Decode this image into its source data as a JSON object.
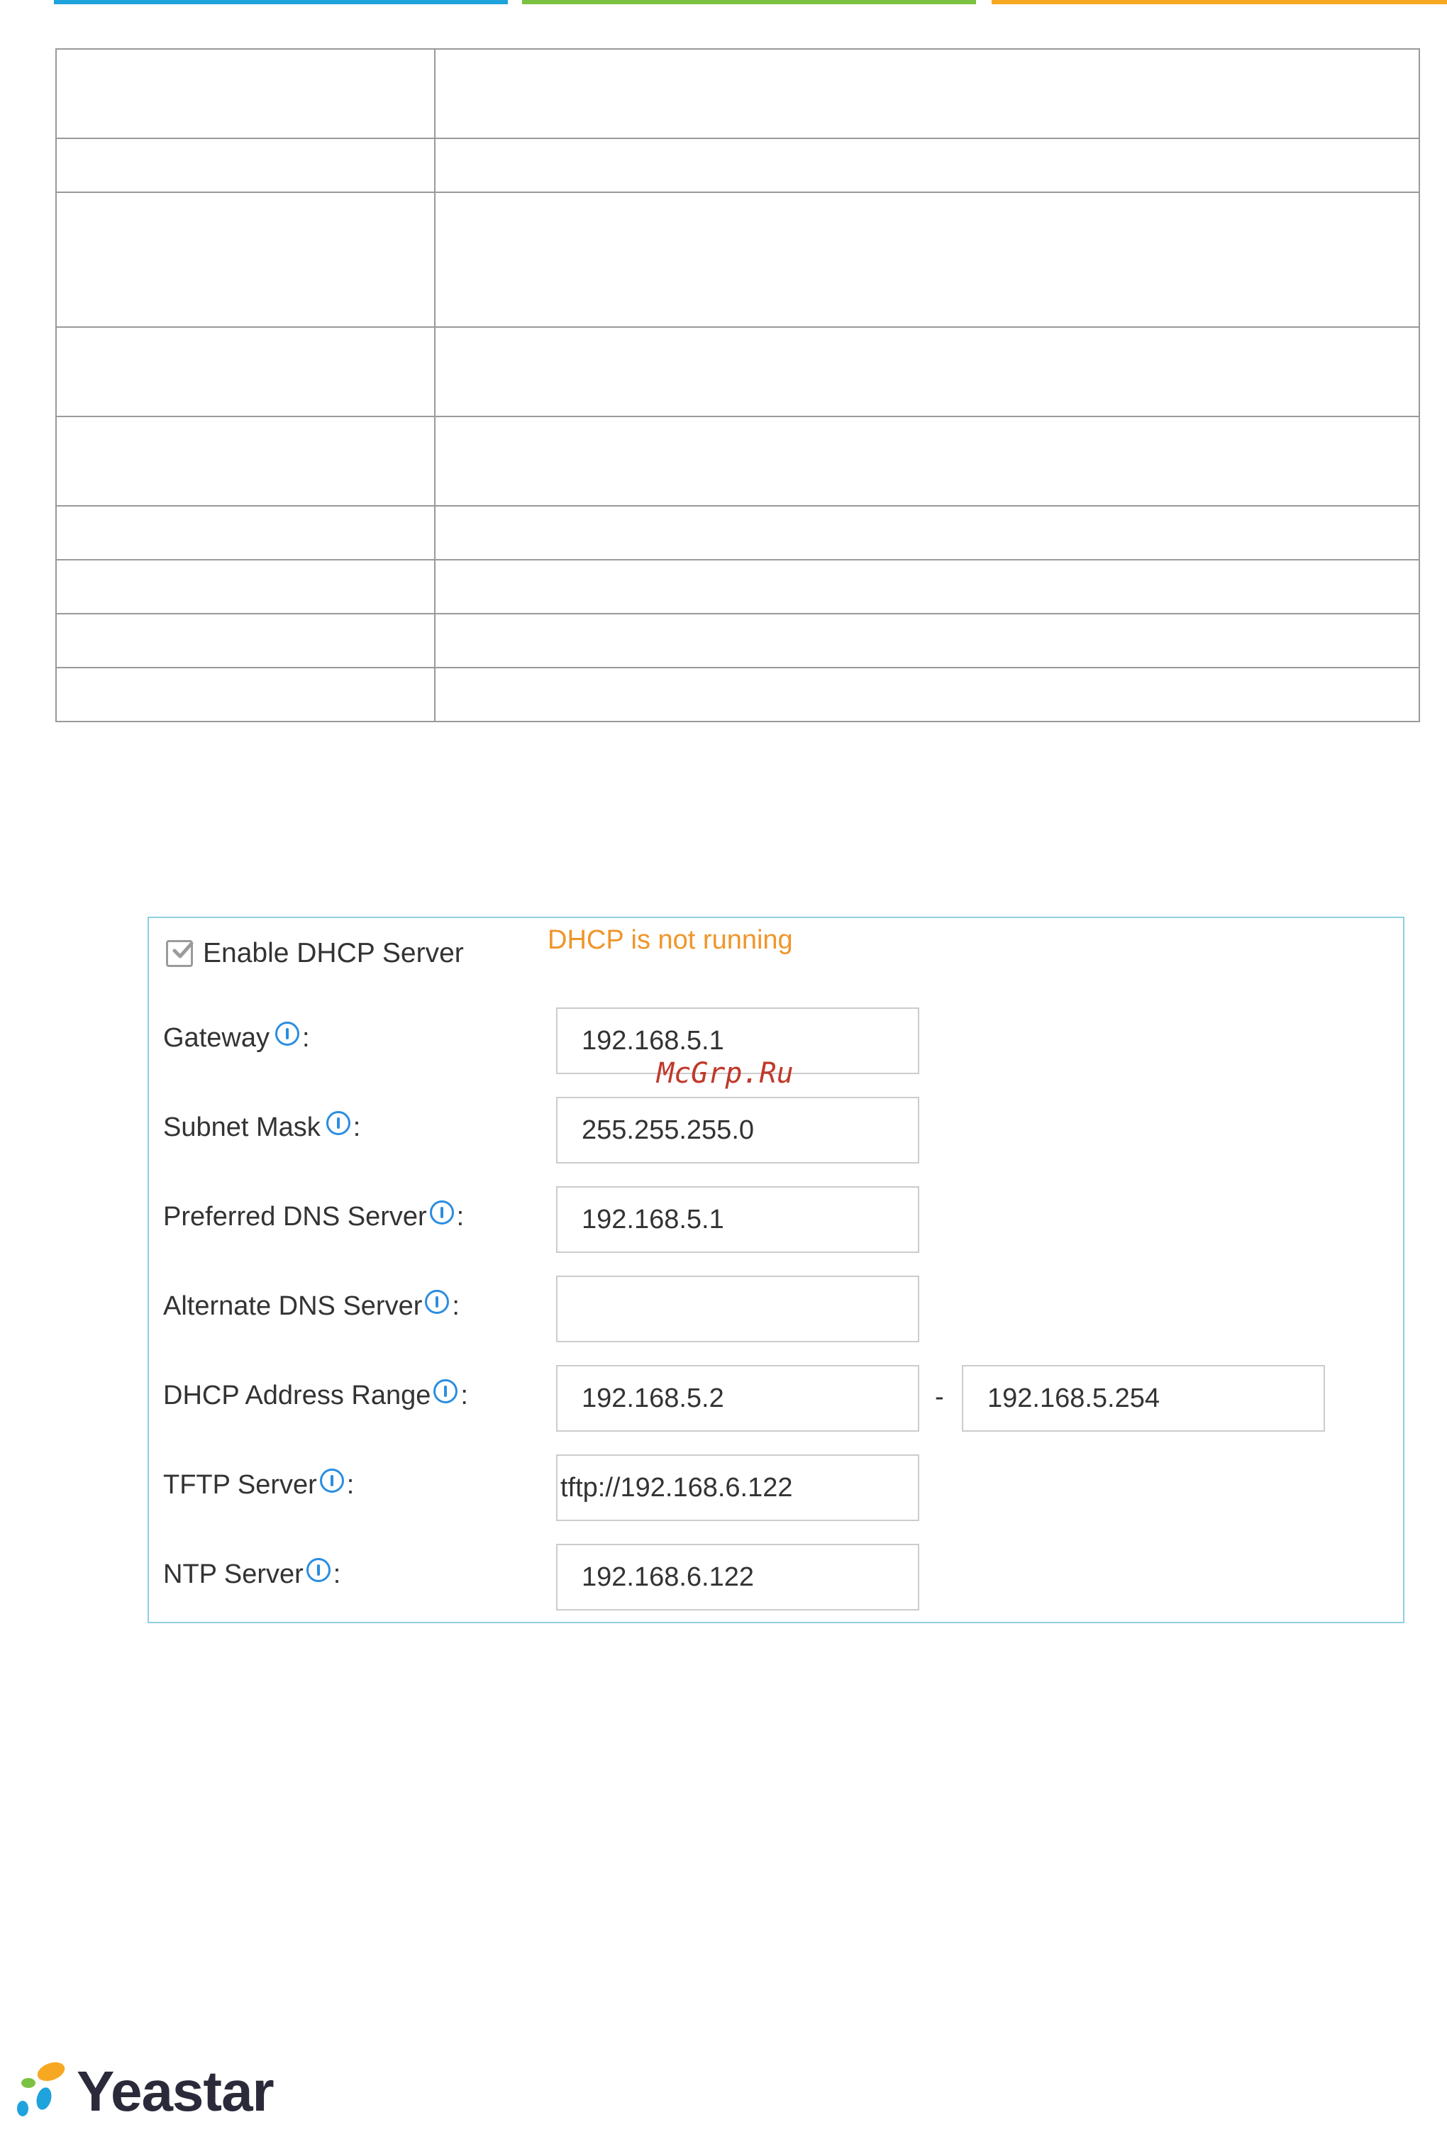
{
  "colors": {
    "bar_blue": "#1ea3dc",
    "bar_green": "#7cc242",
    "bar_orange": "#f7a823",
    "status_orange": "#f0952a",
    "info_blue": "#2a8de0",
    "panel_border": "#8fcfe0",
    "watermark_red": "#c0392b"
  },
  "table": {
    "rows": [
      "",
      "",
      "",
      "",
      "",
      "",
      "",
      "",
      ""
    ]
  },
  "dhcp": {
    "enable_label": "Enable DHCP Server",
    "enabled": true,
    "status": "DHCP is not running",
    "gateway_label": "Gateway",
    "gateway_value": "192.168.5.1",
    "subnet_label": "Subnet Mask",
    "subnet_value": "255.255.255.0",
    "pref_dns_label": "Preferred DNS Server",
    "pref_dns_value": "192.168.5.1",
    "alt_dns_label": "Alternate DNS Server",
    "alt_dns_value": "",
    "range_label": "DHCP Address Range",
    "range_start": "192.168.5.2",
    "range_separator": "-",
    "range_end": "192.168.5.254",
    "tftp_label": "TFTP Server",
    "tftp_value": "tftp://192.168.6.122",
    "ntp_label": "NTP Server",
    "ntp_value": "192.168.6.122",
    "colon": ":"
  },
  "watermark": "McGrp.Ru",
  "logo": {
    "text": "Yeastar"
  },
  "icons": {
    "checkbox": "checkbox-checked-icon",
    "info": "info-icon"
  }
}
